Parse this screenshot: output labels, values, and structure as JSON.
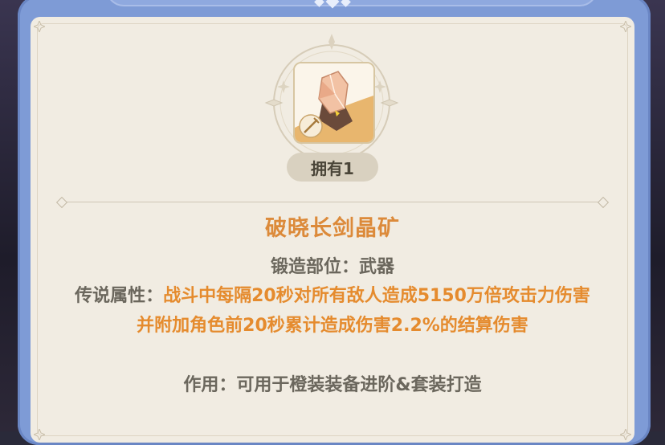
{
  "item": {
    "count_label": "拥有1",
    "name": "破晓长剑晶矿",
    "forge_label": "锻造部位：",
    "forge_value": "武器",
    "legend_label": "传说属性：",
    "legend_desc": "战斗中每隔20秒对所有敌人造成5150万倍攻击力伤害并附加角色前20秒累计造成伤害2.2%的结算伤害",
    "usage_label": "作用：",
    "usage_value": "可用于橙装装备进阶&套装打造",
    "icon": "orange-crystal-ore-with-sword"
  },
  "colors": {
    "frame": "#7e9bd6",
    "panel": "#f1ece2",
    "title": "#dc8a3a",
    "highlight": "#e58b2e",
    "text": "#6b675d",
    "badge": "#d9d1c0"
  }
}
